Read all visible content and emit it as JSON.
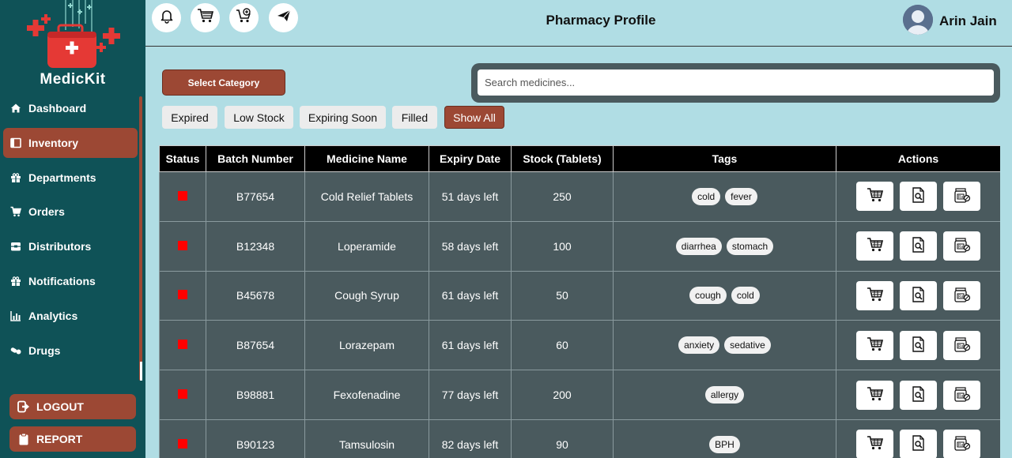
{
  "app": {
    "name": "MedicKit"
  },
  "sidebar": {
    "items": [
      {
        "label": "Dashboard",
        "icon": "home-icon"
      },
      {
        "label": "Inventory",
        "icon": "inventory-icon",
        "active": true
      },
      {
        "label": "Departments",
        "icon": "gift-icon"
      },
      {
        "label": "Orders",
        "icon": "cart-icon"
      },
      {
        "label": "Distributors",
        "icon": "box-icon"
      },
      {
        "label": "Notifications",
        "icon": "gift-icon"
      },
      {
        "label": "Analytics",
        "icon": "chart-icon"
      },
      {
        "label": "Drugs",
        "icon": "pills-icon"
      }
    ],
    "logout_label": "LOGOUT",
    "report_label": "REPORT"
  },
  "header": {
    "title": "Pharmacy Profile",
    "user_name": "Arin Jain",
    "icons": [
      "bell-icon",
      "cart-icon",
      "cart-add-icon",
      "plane-icon"
    ]
  },
  "controls": {
    "select_category_label": "Select Category",
    "search_placeholder": "Search medicines...",
    "filters": [
      "Expired",
      "Low Stock",
      "Expiring Soon",
      "Filled",
      "Show All"
    ],
    "active_filter": "Show All"
  },
  "table": {
    "columns": [
      "Status",
      "Batch Number",
      "Medicine Name",
      "Expiry Date",
      "Stock (Tablets)",
      "Tags",
      "Actions"
    ],
    "rows": [
      {
        "batch": "B77654",
        "name": "Cold Relief Tablets",
        "expiry": "51 days left",
        "stock": "250",
        "tags": [
          "cold",
          "fever"
        ]
      },
      {
        "batch": "B12348",
        "name": "Loperamide",
        "expiry": "58 days left",
        "stock": "100",
        "tags": [
          "diarrhea",
          "stomach"
        ]
      },
      {
        "batch": "B45678",
        "name": "Cough Syrup",
        "expiry": "61 days left",
        "stock": "50",
        "tags": [
          "cough",
          "cold"
        ]
      },
      {
        "batch": "B87654",
        "name": "Lorazepam",
        "expiry": "61 days left",
        "stock": "60",
        "tags": [
          "anxiety",
          "sedative"
        ]
      },
      {
        "batch": "B98881",
        "name": "Fexofenadine",
        "expiry": "77 days left",
        "stock": "200",
        "tags": [
          "allergy"
        ]
      },
      {
        "batch": "B90123",
        "name": "Tamsulosin",
        "expiry": "82 days left",
        "stock": "90",
        "tags": [
          "BPH"
        ]
      }
    ],
    "action_icons": [
      "cart-icon",
      "document-search-icon",
      "prescription-icon"
    ]
  },
  "colors": {
    "sidebar_bg": "#0f5257",
    "accent": "#9c4834",
    "page_bg": "#b0dde4",
    "row_bg": "#4a5a5e",
    "status_red": "#ff0000"
  }
}
